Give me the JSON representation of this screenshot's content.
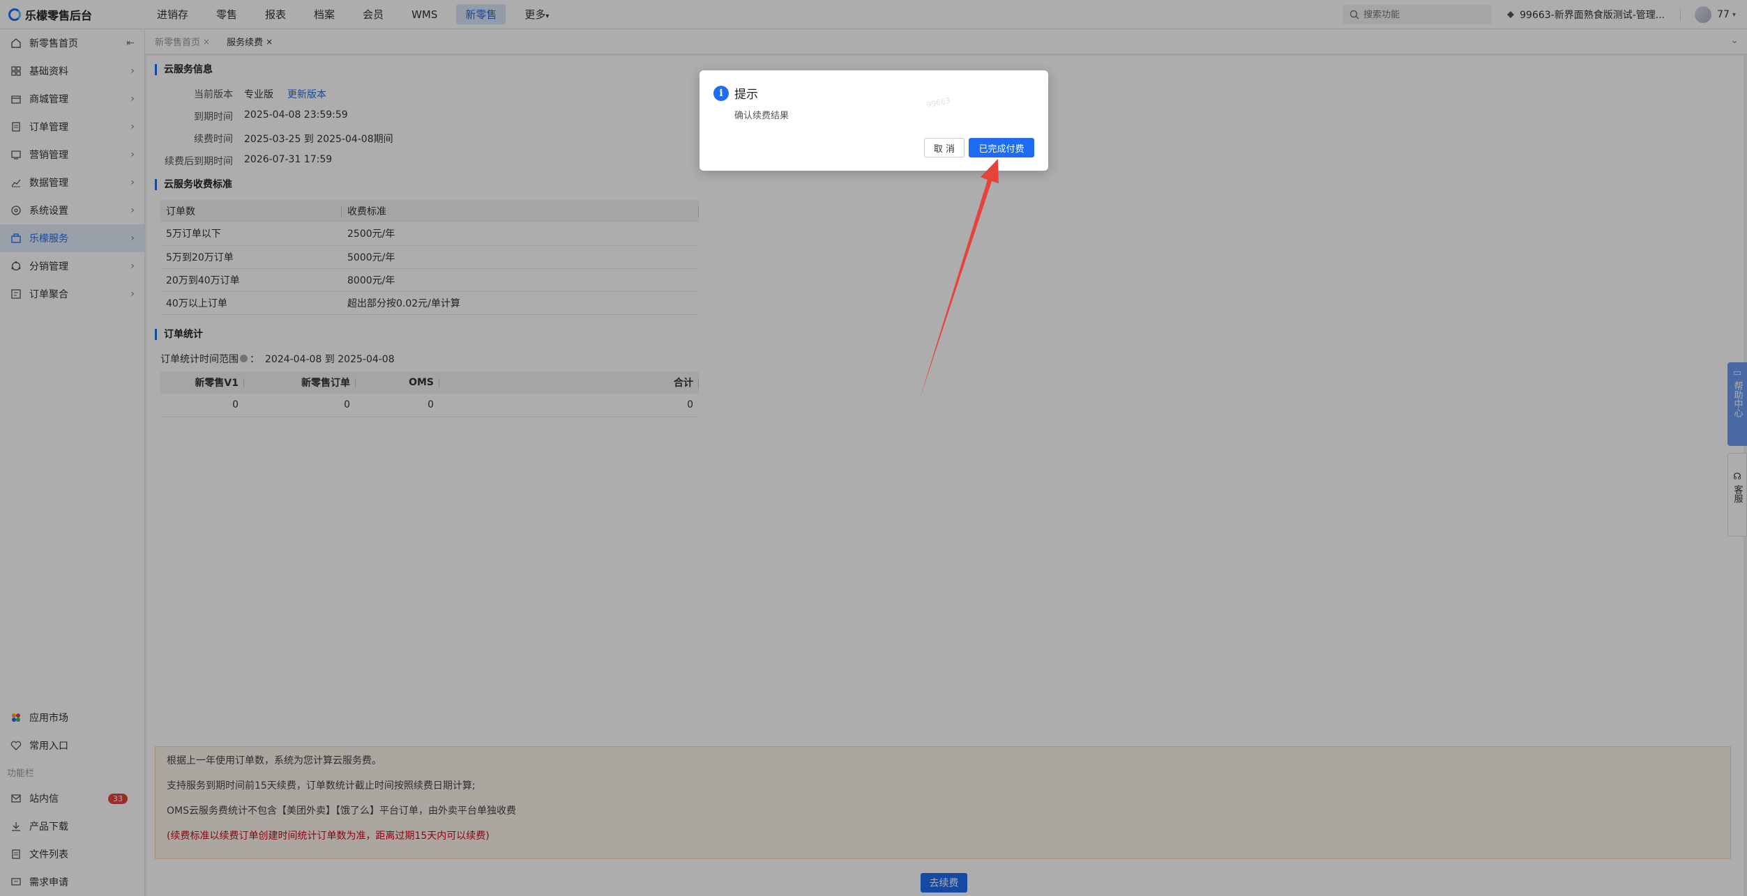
{
  "app": {
    "title": "乐檬零售后台"
  },
  "topnav": {
    "items": [
      "进销存",
      "零售",
      "报表",
      "档案",
      "会员",
      "WMS",
      "新零售",
      "更多"
    ],
    "active": "新零售"
  },
  "search": {
    "placeholder": "搜索功能"
  },
  "store": {
    "name": "99663-新界面熟食版测试-管理..."
  },
  "user": {
    "id": "77"
  },
  "sidebar": {
    "items": [
      {
        "label": "新零售首页",
        "icon": "home-icon"
      },
      {
        "label": "基础资料",
        "icon": "grid-icon"
      },
      {
        "label": "商城管理",
        "icon": "shop-icon"
      },
      {
        "label": "订单管理",
        "icon": "order-icon"
      },
      {
        "label": "营销管理",
        "icon": "marketing-icon"
      },
      {
        "label": "数据管理",
        "icon": "chart-icon"
      },
      {
        "label": "系统设置",
        "icon": "settings-icon"
      },
      {
        "label": "乐檬服务",
        "icon": "service-icon"
      },
      {
        "label": "分销管理",
        "icon": "distribution-icon"
      },
      {
        "label": "订单聚合",
        "icon": "aggregate-icon"
      }
    ],
    "active": "乐檬服务",
    "bottom": {
      "app_market": "应用市场",
      "favorites": "常用入口",
      "section": "功能栏",
      "messages": "站内信",
      "messages_count": "33",
      "downloads": "产品下载",
      "files": "文件列表",
      "requests": "需求申请"
    }
  },
  "tabs": [
    {
      "label": "新零售首页",
      "active": false
    },
    {
      "label": "服务续费",
      "active": true
    }
  ],
  "cloud_info": {
    "title": "云服务信息",
    "version_label": "当前版本",
    "version_value": "专业版",
    "update_link": "更新版本",
    "expire_label": "到期时间",
    "expire_value": "2025-04-08 23:59:59",
    "renew_period_label": "续费时间",
    "renew_period_value": "2025-03-25 到 2025-04-08期间",
    "after_renew_label": "续费后到期时间",
    "after_renew_value": "2026-07-31 17:59"
  },
  "pricing": {
    "title": "云服务收费标准",
    "headers": [
      "订单数",
      "收费标准"
    ],
    "rows": [
      [
        "5万订单以下",
        "2500元/年"
      ],
      [
        "5万到20万订单",
        "5000元/年"
      ],
      [
        "20万到40万订单",
        "8000元/年"
      ],
      [
        "40万以上订单",
        "超出部分按0.02元/单计算"
      ]
    ]
  },
  "order_stats": {
    "title": "订单统计",
    "range_label": "订单统计时间范围",
    "range_value": "2024-04-08 到 2025-04-08",
    "headers": [
      "新零售V1",
      "新零售订单",
      "OMS",
      "合计"
    ],
    "row": [
      "0",
      "0",
      "0",
      "0"
    ]
  },
  "notice": {
    "lines": [
      "根据上一年使用订单数，系统为您计算云服务费。",
      "支持服务到期时间前15天续费，订单数统计截止时间按照续费日期计算;",
      "OMS云服务费统计不包含【美团外卖】【饿了么】平台订单，由外卖平台单独收费"
    ],
    "red_line": "(续费标准以续费订单创建时间统计订单数为准，距离过期15天内可以续费)"
  },
  "renew_button": "去续费",
  "help": {
    "label": "帮助中心"
  },
  "customer_service": {
    "label": "客服"
  },
  "dialog": {
    "title": "提示",
    "message": "确认续费结果",
    "cancel": "取 消",
    "confirm": "已完成付费",
    "watermark": "99663"
  },
  "colors": {
    "accent": "#1e6cf2",
    "arrow": "#e8433b",
    "danger": "#d9001b"
  }
}
